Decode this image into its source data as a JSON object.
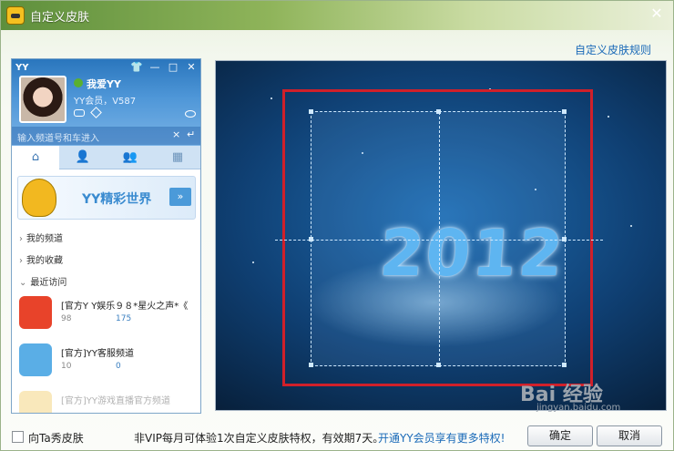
{
  "window": {
    "title": "自定义皮肤",
    "close_glyph": "✕",
    "rules_link": "自定义皮肤规则"
  },
  "preview_client": {
    "app_name": "YY",
    "controls": [
      "👕",
      "—",
      "□",
      "✕"
    ],
    "nickname": "我爱YY",
    "member_text": "YY会员，V587",
    "search_placeholder": "输入频道号和车进入",
    "search_clear": "×",
    "search_go": "↵",
    "tabs": [
      "⌂",
      "👤",
      "👥",
      "▦"
    ],
    "banner_text": "YY精彩世界",
    "banner_arrow": "»",
    "groups": [
      "我的频道",
      "我的收藏",
      "最近访问"
    ],
    "channels": [
      {
        "title": "[官方Y Y娱乐９８*星火之声*《",
        "stat1": "98",
        "stat2": "175"
      },
      {
        "title": "[官方]YY客服频道",
        "stat1": "10",
        "stat2": "0"
      },
      {
        "title": "[官方]YY游戏直播官方频道",
        "stat1": "",
        "stat2": ""
      }
    ]
  },
  "preview_canvas": {
    "art_text": "2012"
  },
  "footer": {
    "checkbox_label": "向Ta秀皮肤",
    "checkbox_checked": false,
    "notice": "非VIP每月可体验1次自定义皮肤特权，有效期7天。",
    "vip_link": "开通YY会员享有更多特权!",
    "ok": "确定",
    "cancel": "取消"
  },
  "watermark": {
    "main": "Bai 经验",
    "sub": "jingyan.baidu.com"
  },
  "colors": {
    "accent": "#1a6ab8",
    "crop_border": "#d0202a",
    "titlebar": "#5e8f3c"
  }
}
